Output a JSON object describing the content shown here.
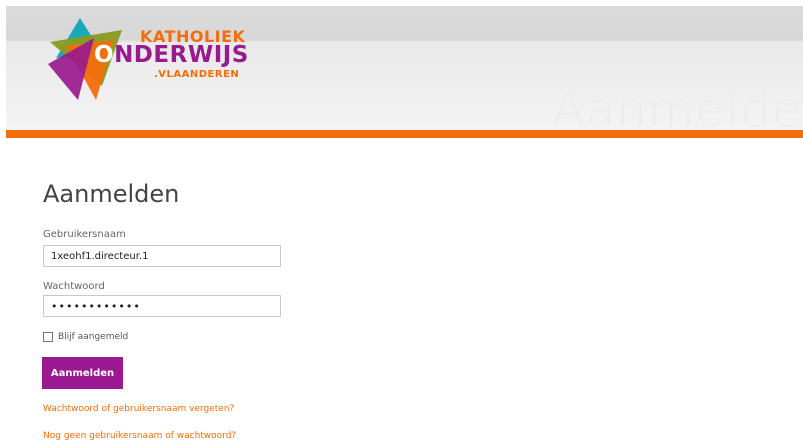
{
  "header": {
    "logo": {
      "line1": "KATHOLIEK",
      "line2_initial": "O",
      "line2_rest": "NDERWIJS",
      "line3": ".VLAANDEREN"
    },
    "watermark": "Aanmelden"
  },
  "main": {
    "title": "Aanmelden",
    "username": {
      "label": "Gebruikersnaam",
      "value": "1xeohf1.directeur.1"
    },
    "password": {
      "label": "Wachtwoord",
      "value": "••••••••••••"
    },
    "remember": {
      "label": "Blijf aangemeld",
      "checked": false
    },
    "submit_label": "Aanmelden",
    "links": {
      "forgot": "Wachtwoord of gebruikersnaam vergeten?",
      "register": "Nog geen gebruikersnaam of wachtwoord?"
    }
  },
  "colors": {
    "brand_orange": "#f36d0b",
    "brand_purple": "#9b1a93",
    "header_gray": "#d9d9d9"
  }
}
